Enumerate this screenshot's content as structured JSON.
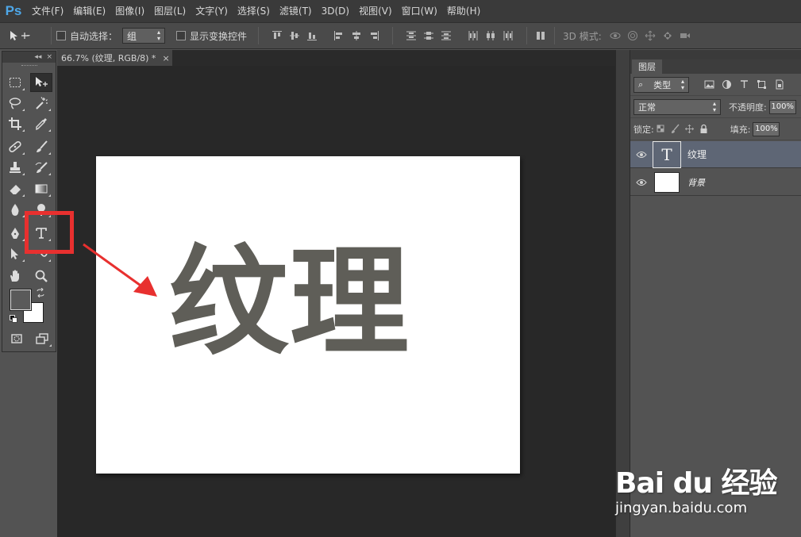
{
  "app": {
    "logo_text": "Ps"
  },
  "menu": [
    "文件(F)",
    "编辑(E)",
    "图像(I)",
    "图层(L)",
    "文字(Y)",
    "选择(S)",
    "滤镜(T)",
    "3D(D)",
    "视图(V)",
    "窗口(W)",
    "帮助(H)"
  ],
  "options_bar": {
    "auto_select_label": "自动选择：",
    "auto_select_value": "组",
    "show_transform_label": "显示变换控件",
    "mode_3d_label": "3D 模式:"
  },
  "document": {
    "tab_title": "66.7% (纹理, RGB/8) *",
    "close_glyph": "×",
    "canvas_text": "纹理",
    "text_color": "#5f5e58"
  },
  "toolbox": {
    "collapse_glyph": "◂◂",
    "close_glyph": "×",
    "tools": [
      {
        "name": "rectangular-marquee",
        "active": false
      },
      {
        "name": "move",
        "active": true
      },
      {
        "name": "lasso",
        "active": false
      },
      {
        "name": "magic-wand",
        "active": false
      },
      {
        "name": "crop",
        "active": false
      },
      {
        "name": "eyedropper",
        "active": false
      },
      {
        "name": "healing-brush",
        "active": false
      },
      {
        "name": "brush",
        "active": false
      },
      {
        "name": "clone-stamp",
        "active": false
      },
      {
        "name": "history-brush",
        "active": false
      },
      {
        "name": "eraser",
        "active": false
      },
      {
        "name": "gradient",
        "active": false
      },
      {
        "name": "blur",
        "active": false
      },
      {
        "name": "dodge",
        "active": false
      },
      {
        "name": "pen",
        "active": false
      },
      {
        "name": "type",
        "active": false
      },
      {
        "name": "path-selection",
        "active": false
      },
      {
        "name": "shape",
        "active": false
      },
      {
        "name": "hand",
        "active": false
      },
      {
        "name": "zoom",
        "active": false
      }
    ],
    "foreground_color": "#5a5a5a",
    "background_color": "#ffffff"
  },
  "layers_panel": {
    "tab_label": "图层",
    "filter_label": "类型",
    "blend_mode": "正常",
    "opacity_label": "不透明度:",
    "opacity_value": "100%",
    "lock_label": "锁定:",
    "fill_label": "填充:",
    "fill_value": "100%",
    "layers": [
      {
        "name": "纹理",
        "type": "text",
        "thumb_glyph": "T",
        "selected": true
      },
      {
        "name": "背景",
        "type": "background",
        "selected": false
      }
    ]
  },
  "annotation": {
    "highlight_color": "#e8302f"
  },
  "watermark": {
    "logo": "Bai du 经验",
    "url": "jingyan.baidu.com"
  }
}
